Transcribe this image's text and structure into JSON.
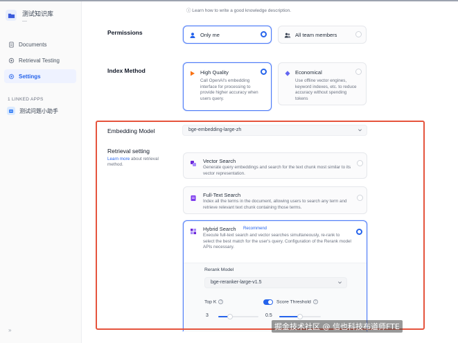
{
  "sidebar": {
    "dataset_name": "测试知识库",
    "dataset_sub": "—",
    "nav": [
      {
        "label": "Documents",
        "icon": "document-icon"
      },
      {
        "label": "Retrieval Testing",
        "icon": "target-icon"
      },
      {
        "label": "Settings",
        "icon": "gear-icon",
        "active": true
      }
    ],
    "linked_title": "1 LINKED APPS",
    "linked_app": "测试问题小助手",
    "collapse_label": "»"
  },
  "main": {
    "learn_top": "ⓘ Learn how to write a good knowledge description.",
    "permissions": {
      "label": "Permissions",
      "options": [
        {
          "title": "Only me",
          "selected": true
        },
        {
          "title": "All team members",
          "selected": false
        }
      ]
    },
    "index_method": {
      "label": "Index Method",
      "options": [
        {
          "title": "High Quality",
          "desc": "Call OpenAI's embedding interface for processing to provide higher accuracy when users query.",
          "selected": true
        },
        {
          "title": "Economical",
          "desc": "Use offline vector engines, keyword indexes, etc. to reduce accuracy without spending tokens",
          "selected": false
        }
      ]
    },
    "embedding": {
      "label": "Embedding Model",
      "value": "bge-embedding-large-zh"
    },
    "retrieval": {
      "label": "Retrieval setting",
      "learn_more_link": "Learn more",
      "learn_more_rest": " about retrieval method.",
      "methods": [
        {
          "title": "Vector Search",
          "desc": "Generate query embeddings and search for the text chunk most similar to its vector representation.",
          "selected": false
        },
        {
          "title": "Full-Text Search",
          "desc": "Index all the terms in the document, allowing users to search any term and retrieve relevant text chunk containing those terms.",
          "selected": false
        },
        {
          "title": "Hybrid Search",
          "badge": "Recommend",
          "desc": "Execute full-text search and vector searches simultaneously, re-rank to select the best match for the user's query. Configuration of the Rerank model APIs necessary.",
          "selected": true
        }
      ],
      "rerank_label": "Rerank Model",
      "rerank_value": "bge-reranker-large-v1.5",
      "topk_label": "Top K",
      "topk_value": "3",
      "topk_fraction": 0.3,
      "score_label": "Score Threshold",
      "score_enabled": true,
      "score_value": "0.5",
      "score_fraction": 0.5
    }
  },
  "watermark": "掘金技术社区 @ 信也科技布道师FTE",
  "colors": {
    "accent": "#2563eb",
    "highlight": "#e5533c"
  }
}
